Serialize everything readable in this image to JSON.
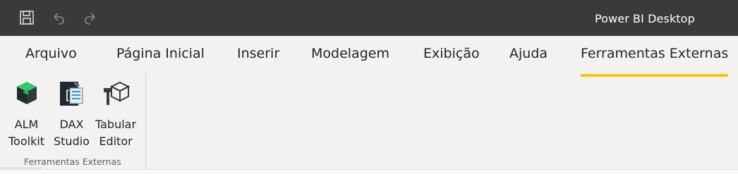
{
  "window": {
    "title": "Power BI Desktop"
  },
  "quick_access": [
    {
      "icon": "save-icon"
    },
    {
      "icon": "undo-icon"
    },
    {
      "icon": "redo-icon"
    }
  ],
  "tabs": [
    {
      "label": "Arquivo"
    },
    {
      "label": "Página Inicial"
    },
    {
      "label": "Inserir"
    },
    {
      "label": "Modelagem"
    },
    {
      "label": "Exibição"
    },
    {
      "label": "Ajuda"
    },
    {
      "label": "Ferramentas Externas",
      "active": true
    }
  ],
  "ribbon": {
    "group_label": "Ferramentas Externas",
    "buttons": [
      {
        "line1": "ALM",
        "line2": "Toolkit",
        "icon": "alm-toolkit-icon"
      },
      {
        "line1": "DAX",
        "line2": "Studio",
        "icon": "dax-studio-icon"
      },
      {
        "line1": "Tabular",
        "line2": "Editor",
        "icon": "tabular-editor-icon"
      }
    ]
  },
  "colors": {
    "titlebar": "#3b3a39",
    "accent": "#f2c811",
    "ribbon_bg": "#f3f2f1"
  }
}
